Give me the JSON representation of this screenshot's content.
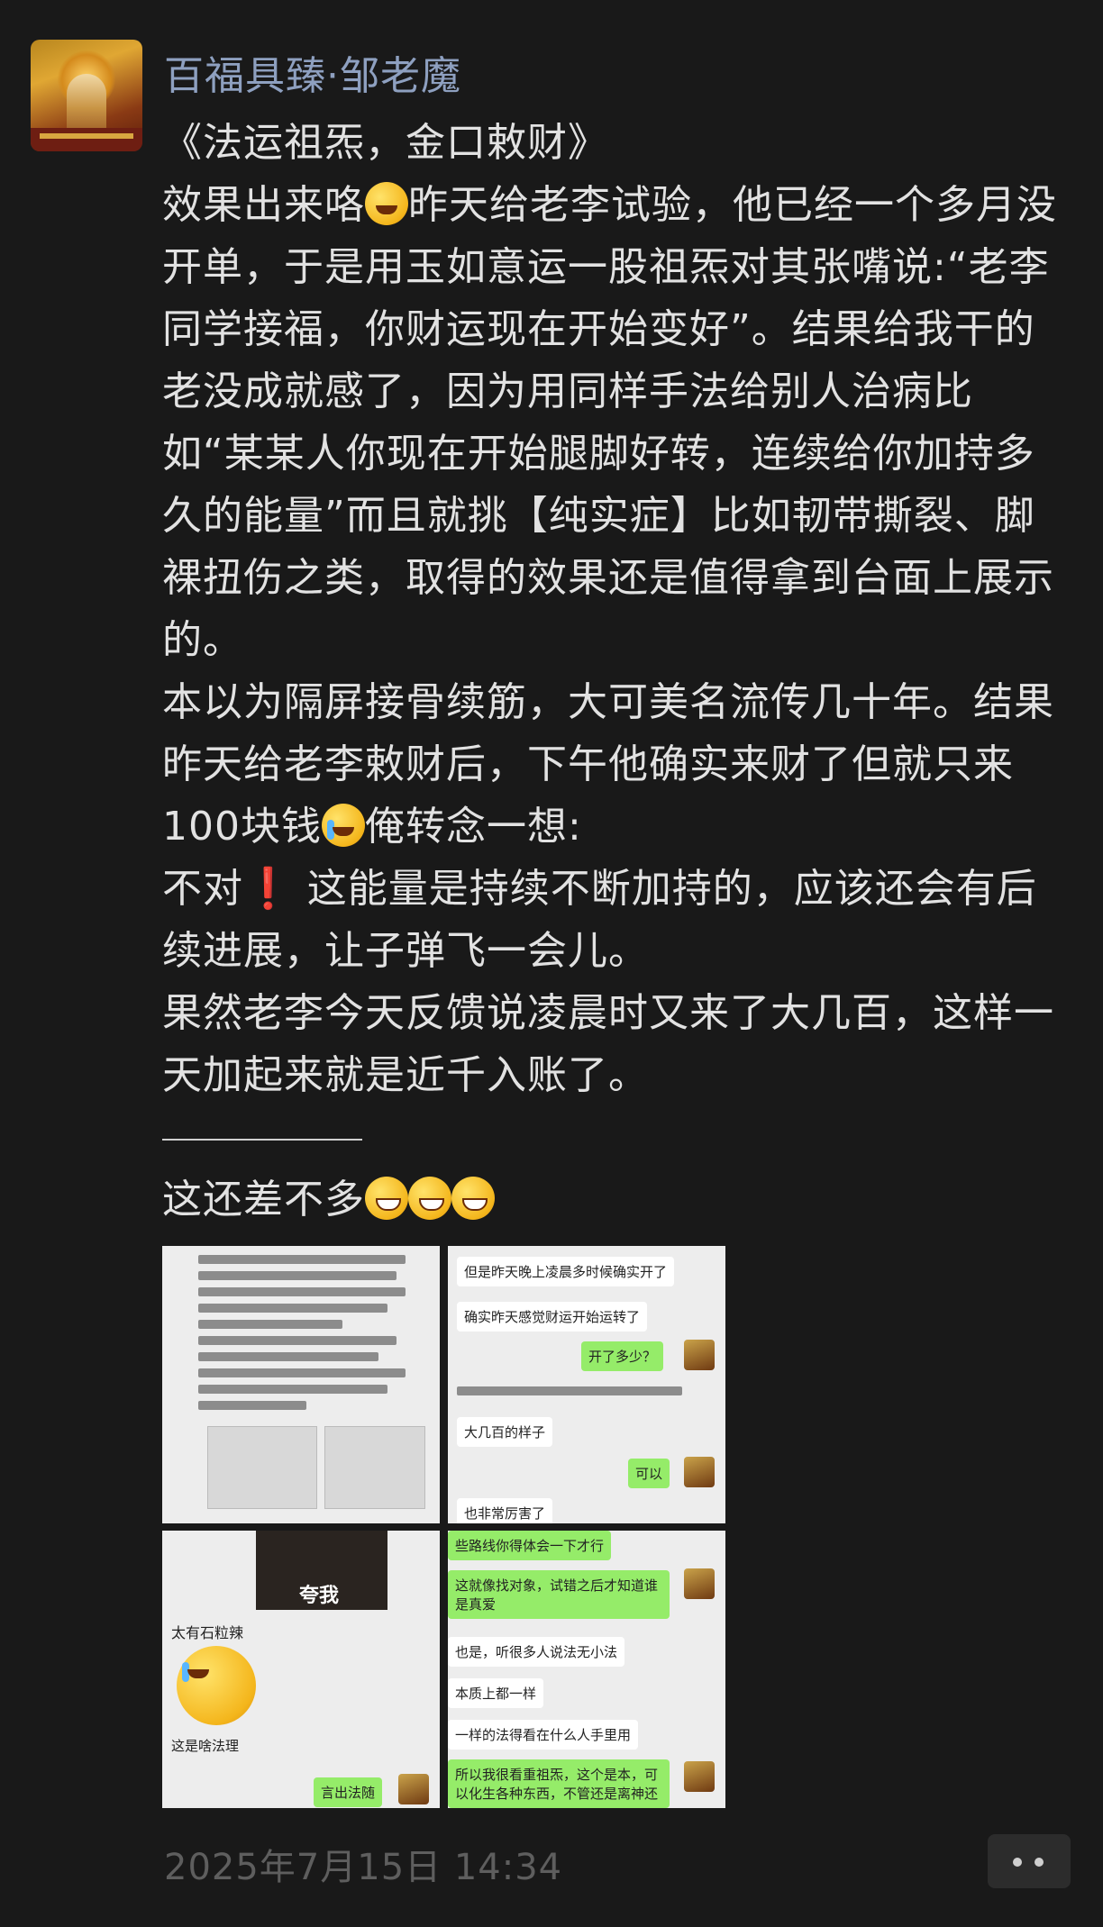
{
  "post": {
    "author": "百福具臻·邹老魔",
    "timestamp": "2025年7月15日 14:34",
    "paragraphs": {
      "p1": "《法运祖炁，金口敕财》",
      "p2a": "效果出来咯",
      "p2b": "昨天给老李试验，他已经一个多月没开单，于是用玉如意运一股祖炁对其张嘴说:“老李同学接福，你财运现在开始变好”。结果给我干的老没成就感了，因为用同样手法给别人治病比如“某某人你现在开始腿脚好转，连续给你加持多久的能量”而且就挑【纯实症】比如韧带撕裂、脚裸扭伤之类，取得的效果还是值得拿到台面上展示的。",
      "p3a": "本以为隔屏接骨续筋，大可美名流传几十年。结果昨天给老李敕财后，下午他确实来财了但就只来100块钱",
      "p3b": "俺转念一想:",
      "p4a": "不对",
      "p4b": "这能量是持续不断加持的，应该还会有后续进展，让子弹飞一会儿。",
      "p5": "果然老李今天反馈说凌晨时又来了大几百，这样一天加起来就是近千入账了。",
      "p7": "这还差不多"
    },
    "emoji": {
      "laugh_cry": "face-with-tears-of-joy",
      "crying": "loudly-crying-face",
      "grin": "grinning-face",
      "exclaim": "❗"
    }
  },
  "thumbnails": {
    "t1": {
      "label": "screenshot-text-post"
    },
    "t2": {
      "m1": "但是昨天晚上凌晨多时候确实开了",
      "m2": "确实昨天感觉财运开始运转了",
      "m3": "开了多少？",
      "m4": "大几百的样子",
      "m5": "可以",
      "m6": "也非常厉害了"
    },
    "t3": {
      "caption": "夸我",
      "m1": "太有石粒辣",
      "m2": "这是啥法理",
      "m3": "言出法随"
    },
    "t4": {
      "m1": "些路线你得体会一下才行",
      "m2": "这就像找对象，试错之后才知道谁是真爱",
      "m3": "也是，听很多人说法无小法",
      "m4": "本质上都一样",
      "m5": "一样的法得看在什么人手里用",
      "m6": "所以我很看重祖炁，这个是本，可以化生各种东西，不管还是离神还"
    }
  },
  "colors": {
    "background": "#191919",
    "author": "#8ea0c0",
    "text": "#e2e2e2",
    "timestamp": "#5e5e5e",
    "wechat_green": "#95ec69"
  }
}
